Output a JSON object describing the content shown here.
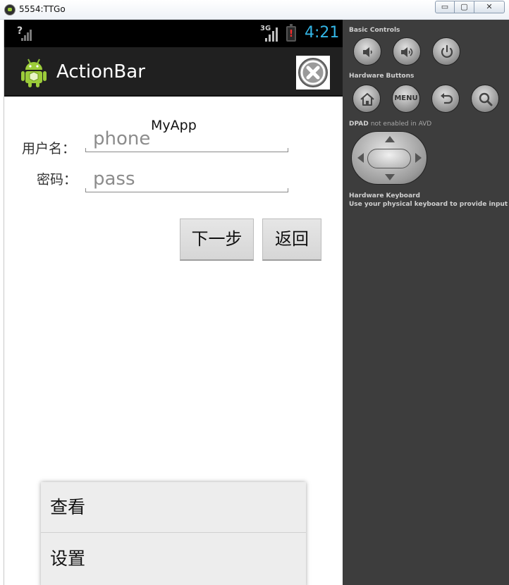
{
  "window": {
    "title": "5554:TTGo",
    "minimize_label": "▭",
    "maximize_label": "▢",
    "close_label": "✕"
  },
  "statusbar": {
    "signal_unknown": "?",
    "network_type": "3G",
    "battery_alert": "!",
    "time": "4:21",
    "clock_color": "#33b5e5"
  },
  "actionbar": {
    "title": "ActionBar",
    "app_icon": "android-icon",
    "action_icon": "close-circle-icon"
  },
  "form": {
    "username_label": "用户名：",
    "username_placeholder": "phone",
    "password_label": "密码：",
    "password_placeholder": "pass",
    "toast_text": "MyApp",
    "next_button": "下一步",
    "back_button": "返回"
  },
  "options_menu": {
    "items": [
      {
        "label": "查看"
      },
      {
        "label": "设置"
      }
    ]
  },
  "controls": {
    "basic_controls_title": "Basic Controls",
    "hardware_buttons_title": "Hardware Buttons",
    "dpad_title": "DPAD",
    "dpad_note": "not enabled in AVD",
    "keyboard_title": "Hardware Keyboard",
    "keyboard_note": "Use your physical keyboard to provide input",
    "menu_button_label": "MENU",
    "basic_buttons": [
      "volume-down-icon",
      "volume-up-icon",
      "power-icon"
    ],
    "hardware_buttons": [
      "home-icon",
      "menu-button",
      "back-icon",
      "search-icon"
    ]
  }
}
